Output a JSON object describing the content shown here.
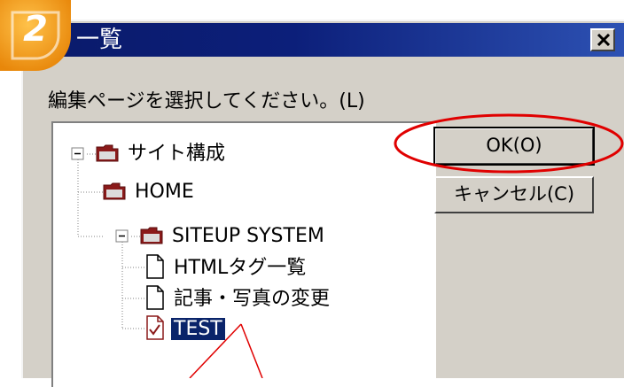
{
  "dialog": {
    "title": "一覧",
    "close_icon": "close-icon",
    "prompt": "編集ページを選択してください。(L)"
  },
  "tree": {
    "nodes": [
      {
        "label": "サイト構成",
        "icon": "folder-icon",
        "expander": "minus"
      },
      {
        "label": "HOME",
        "icon": "folder-icon"
      },
      {
        "label": "SITEUP SYSTEM",
        "icon": "folder-icon",
        "expander": "minus"
      },
      {
        "label": "HTMLタグ一覧",
        "icon": "page-icon"
      },
      {
        "label": "記事・写真の変更",
        "icon": "page-icon"
      },
      {
        "label": "TEST",
        "icon": "checked-page-icon",
        "selected": true
      }
    ]
  },
  "buttons": {
    "ok": "OK(O)",
    "cancel": "キャンセル(C)"
  },
  "annotation": {
    "step_number": "2",
    "badge_color": "#f39c12",
    "highlight_color": "#e00000"
  }
}
